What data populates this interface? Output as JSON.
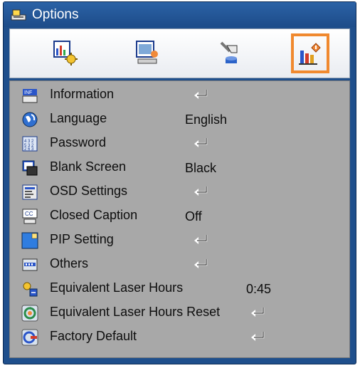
{
  "window": {
    "title": "Options"
  },
  "tabs": [
    {
      "icon": "image-settings-icon",
      "selected": false
    },
    {
      "icon": "display-settings-icon",
      "selected": false
    },
    {
      "icon": "setup-tools-icon",
      "selected": false
    },
    {
      "icon": "options-info-icon",
      "selected": true
    }
  ],
  "menu": {
    "items": [
      {
        "label": "Information",
        "value": "",
        "enter": true,
        "icon": "information-icon"
      },
      {
        "label": "Language",
        "value": "English",
        "enter": false,
        "icon": "language-globe-icon"
      },
      {
        "label": "Password",
        "value": "",
        "enter": true,
        "icon": "password-keypad-icon"
      },
      {
        "label": "Blank Screen",
        "value": "Black",
        "enter": false,
        "icon": "blank-screen-icon"
      },
      {
        "label": "OSD Settings",
        "value": "",
        "enter": true,
        "icon": "osd-settings-icon"
      },
      {
        "label": "Closed Caption",
        "value": "Off",
        "enter": false,
        "icon": "closed-caption-icon"
      },
      {
        "label": "PIP Setting",
        "value": "",
        "enter": true,
        "icon": "pip-setting-icon"
      },
      {
        "label": "Others",
        "value": "",
        "enter": true,
        "icon": "others-icon"
      },
      {
        "label": "Equivalent Laser Hours",
        "value": "0:45",
        "enter": false,
        "icon": "laser-hours-icon"
      },
      {
        "label": "Equivalent Laser Hours Reset",
        "value": "",
        "enter": true,
        "icon": "laser-reset-icon"
      },
      {
        "label": "Factory Default",
        "value": "",
        "enter": true,
        "icon": "factory-default-icon"
      }
    ]
  },
  "colors": {
    "frame": "#1f4f8c",
    "panel": "#a8a8a8",
    "selection": "#f0892f"
  }
}
